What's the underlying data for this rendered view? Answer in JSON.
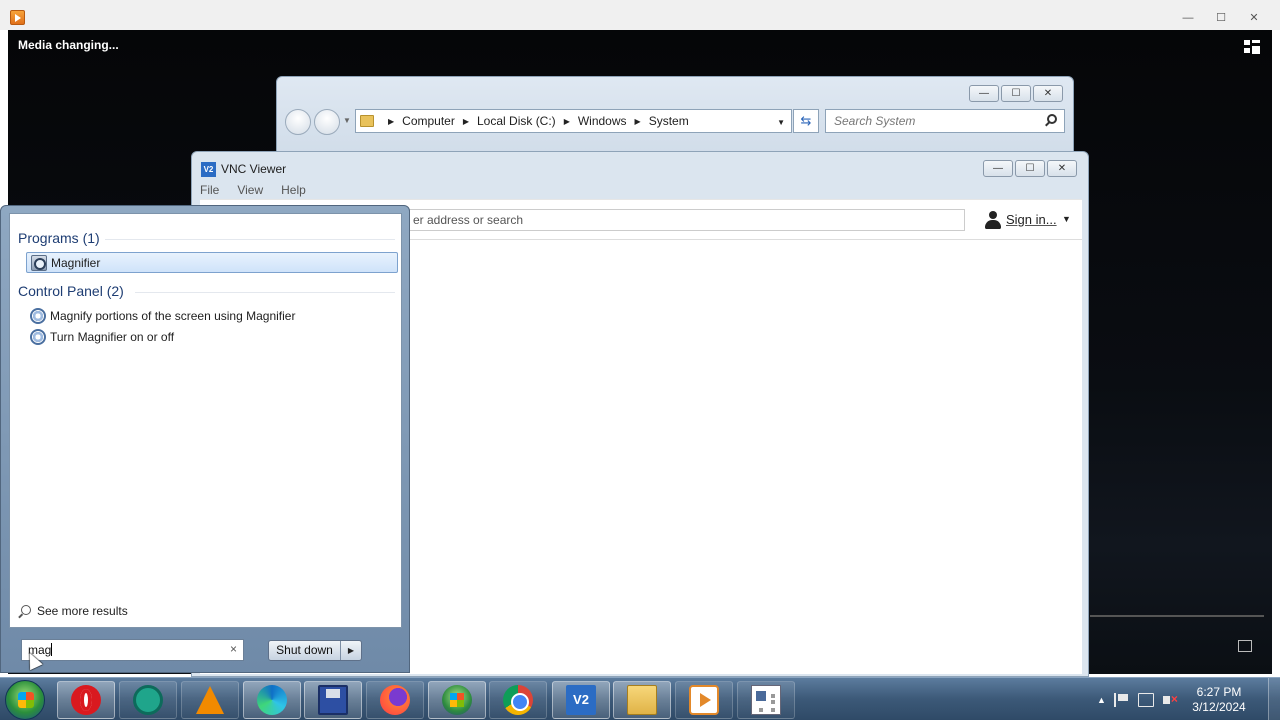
{
  "media_player": {
    "status_text": "Media changing...",
    "window_controls": {
      "minimize": "—",
      "maximize": "☐",
      "close": "✕"
    }
  },
  "explorer": {
    "breadcrumbs": [
      "Computer",
      "Local Disk (C:)",
      "Windows",
      "System"
    ],
    "search_placeholder": "Search System",
    "window_controls": {
      "minimize": "—",
      "maximize": "☐",
      "close": "✕"
    }
  },
  "vnc_viewer": {
    "title": "VNC Viewer",
    "icon_text": "V2",
    "menu": [
      "File",
      "View",
      "Help"
    ],
    "search_text": "er address or search",
    "sign_in": "Sign in...",
    "window_controls": {
      "minimize": "—",
      "maximize": "☐",
      "close": "✕"
    }
  },
  "start_menu": {
    "groups": [
      {
        "header": "Programs (1)",
        "items": [
          {
            "label": "Magnifier",
            "icon": "magnifier-icon",
            "selected": true
          }
        ]
      },
      {
        "header": "Control Panel (2)",
        "items": [
          {
            "label": "Magnify portions of the screen using Magnifier",
            "icon": "ease-of-access-icon",
            "selected": false
          },
          {
            "label": "Turn Magnifier on or off",
            "icon": "ease-of-access-icon",
            "selected": false
          }
        ]
      }
    ],
    "see_more": "See more results",
    "search_value": "mag",
    "clear_glyph": "×",
    "shutdown_label": "Shut down",
    "shutdown_arrow": "▶"
  },
  "taskbar": {
    "apps": [
      {
        "name": "opera",
        "state": "active"
      },
      {
        "name": "chat-app",
        "state": "inactive"
      },
      {
        "name": "vlc",
        "state": "inactive"
      },
      {
        "name": "edge",
        "state": "active"
      },
      {
        "name": "floppy-save",
        "state": "active"
      },
      {
        "name": "firefox",
        "state": "inactive"
      },
      {
        "name": "windows-logo",
        "state": "active"
      },
      {
        "name": "chrome",
        "state": "inactive"
      },
      {
        "name": "vnc-viewer",
        "state": "active",
        "icon_text": "V2"
      },
      {
        "name": "file-explorer",
        "state": "active"
      },
      {
        "name": "media-player",
        "state": "inactive"
      },
      {
        "name": "news-app",
        "state": "inactive"
      }
    ],
    "tray_arrow": "▲",
    "clock_time": "6:27 PM",
    "clock_date": "3/12/2024"
  }
}
